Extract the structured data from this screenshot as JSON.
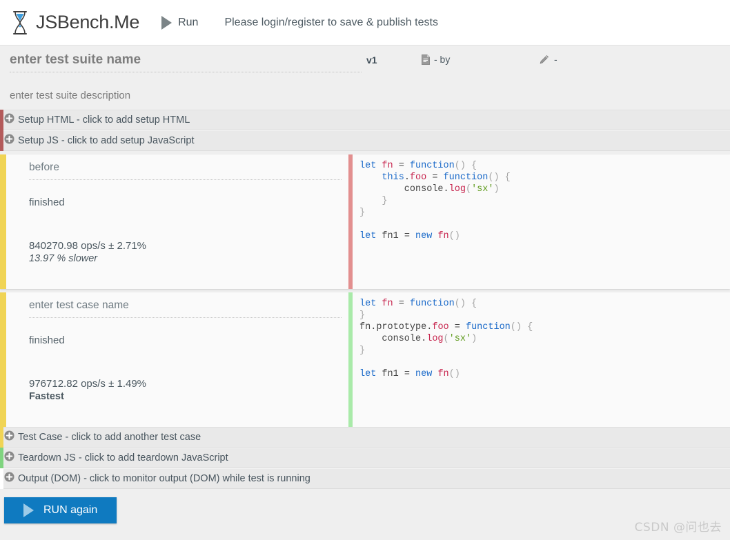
{
  "navbar": {
    "brand_name": "JSBench.Me",
    "logo_icon": "hourglass-icon",
    "run_icon": "play-triangle-icon",
    "run_label": "Run",
    "notice": "Please login/register to save & publish tests"
  },
  "suite": {
    "title_placeholder": "enter test suite name",
    "version": "v1",
    "doc_icon": "document-icon",
    "author_text": "- by",
    "pencil_icon": "pencil-icon",
    "edited_text": "-",
    "description_placeholder": "enter test suite description"
  },
  "setup_strips": [
    {
      "plus_icon": "plus-circle-icon",
      "label": "Setup HTML - click to add setup HTML",
      "accent": "#b45b5b"
    },
    {
      "plus_icon": "plus-circle-icon",
      "label": "Setup JS - click to add setup JavaScript",
      "accent": "#b45b5b"
    }
  ],
  "test_cases": [
    {
      "name": "before",
      "name_is_placeholder": false,
      "status": "finished",
      "ops": "840270.98 ops/s ± 2.71%",
      "relative": "13.97 % slower",
      "relative_style": "slower",
      "accent": "#f0d455",
      "code_accent": "#e28f8f",
      "code_lines": [
        [
          [
            "let ",
            "kw"
          ],
          [
            "fn",
            "var"
          ],
          [
            " = ",
            "op"
          ],
          [
            "function",
            "fn"
          ],
          [
            "() {",
            "punc"
          ]
        ],
        [
          [
            "    ",
            "plain"
          ],
          [
            "this",
            "kw"
          ],
          [
            ".",
            "op"
          ],
          [
            "foo",
            "var"
          ],
          [
            " = ",
            "op"
          ],
          [
            "function",
            "fn"
          ],
          [
            "() {",
            "punc"
          ]
        ],
        [
          [
            "        console",
            "plain"
          ],
          [
            ".",
            "op"
          ],
          [
            "log",
            "var"
          ],
          [
            "(",
            "punc"
          ],
          [
            "'sx'",
            "str"
          ],
          [
            ")",
            "punc"
          ]
        ],
        [
          [
            "    }",
            "punc"
          ]
        ],
        [
          [
            "}",
            "punc"
          ]
        ],
        [
          [
            "",
            ""
          ]
        ],
        [
          [
            "let ",
            "kw"
          ],
          [
            "fn1",
            "plain"
          ],
          [
            " = ",
            "op"
          ],
          [
            "new ",
            "kw"
          ],
          [
            "fn",
            "var"
          ],
          [
            "()",
            "punc"
          ]
        ]
      ]
    },
    {
      "name": "enter test case name",
      "name_is_placeholder": true,
      "status": "finished",
      "ops": "976712.82 ops/s ± 1.49%",
      "relative": "Fastest",
      "relative_style": "fastest",
      "accent": "#f0d455",
      "code_accent": "#a9eaa9",
      "code_lines": [
        [
          [
            "let ",
            "kw"
          ],
          [
            "fn",
            "var"
          ],
          [
            " = ",
            "op"
          ],
          [
            "function",
            "fn"
          ],
          [
            "() {",
            "punc"
          ]
        ],
        [
          [
            "}",
            "punc"
          ]
        ],
        [
          [
            "fn",
            "plain"
          ],
          [
            ".",
            "op"
          ],
          [
            "prototype",
            "plain"
          ],
          [
            ".",
            "op"
          ],
          [
            "foo",
            "var"
          ],
          [
            " = ",
            "op"
          ],
          [
            "function",
            "fn"
          ],
          [
            "() {",
            "punc"
          ]
        ],
        [
          [
            "    console",
            "plain"
          ],
          [
            ".",
            "op"
          ],
          [
            "log",
            "var"
          ],
          [
            "(",
            "punc"
          ],
          [
            "'sx'",
            "str"
          ],
          [
            ")",
            "punc"
          ]
        ],
        [
          [
            "}",
            "punc"
          ]
        ],
        [
          [
            "",
            ""
          ]
        ],
        [
          [
            "let ",
            "kw"
          ],
          [
            "fn1",
            "plain"
          ],
          [
            " = ",
            "op"
          ],
          [
            "new ",
            "kw"
          ],
          [
            "fn",
            "var"
          ],
          [
            "()",
            "punc"
          ]
        ]
      ]
    }
  ],
  "bottom_strips": [
    {
      "plus_icon": "plus-circle-icon",
      "label": "Test Case - click to add another test case",
      "accent": "#f0d455"
    },
    {
      "plus_icon": "plus-circle-icon",
      "label": "Teardown JS - click to add teardown JavaScript",
      "accent": "#7fd47f"
    },
    {
      "plus_icon": "plus-circle-icon",
      "label": "Output (DOM) - click to monitor output (DOM) while test is running",
      "accent": "#ffffff"
    }
  ],
  "run_bar": {
    "play_icon": "play-triangle-icon",
    "label": "RUN again",
    "color": "#0f7ac0"
  },
  "watermark": "CSDN @问也去"
}
